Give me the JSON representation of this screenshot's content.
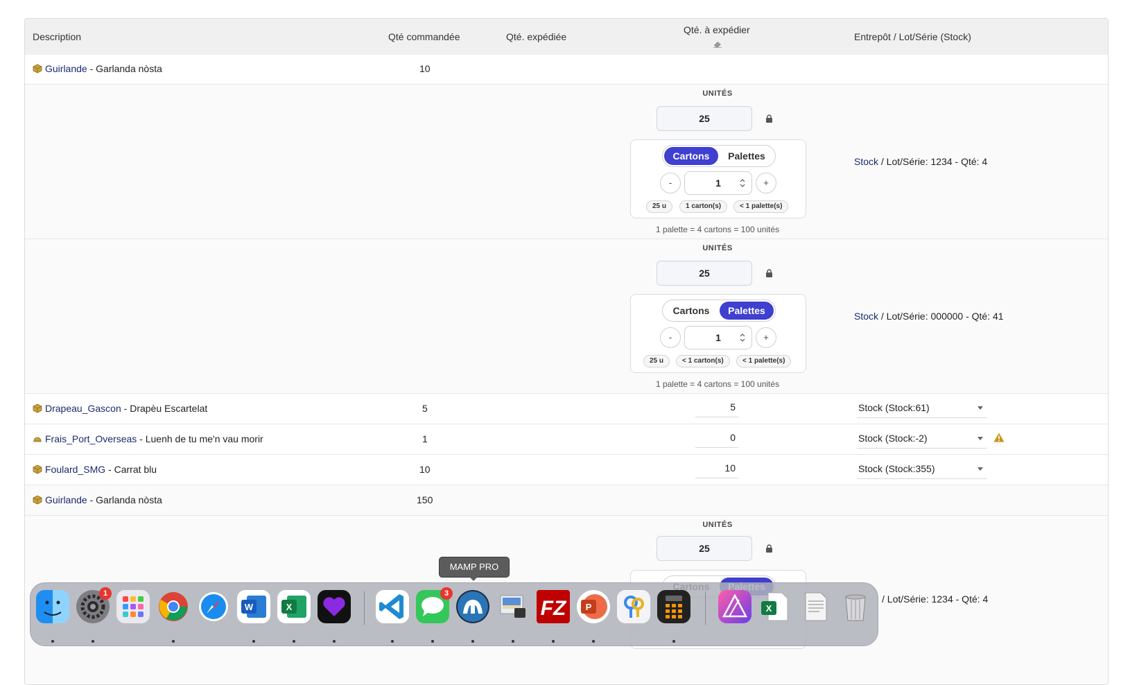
{
  "header": {
    "description": "Description",
    "ordered": "Qté commandée",
    "shipped": "Qté. expédiée",
    "to_ship": "Qté. à expédier",
    "warehouse": "Entrepôt / Lot/Série (Stock)"
  },
  "rows": [
    {
      "product": "Guirlande",
      "label": "Garlanda nòsta",
      "ordered": "10"
    },
    {
      "product": "Drapeau_Gascon",
      "label": "Drapèu Escartelat",
      "ordered": "5",
      "to_ship": "5",
      "stock": "Stock (Stock:61)"
    },
    {
      "product": "Frais_Port_Overseas",
      "label": "Luenh de tu me'n vau morir",
      "ordered": "1",
      "to_ship": "0",
      "stock": "Stock (Stock:-2)"
    },
    {
      "product": "Foulard_SMG",
      "label": "Carrat blu",
      "ordered": "10",
      "to_ship": "10",
      "stock": "Stock (Stock:355)"
    },
    {
      "product": "Guirlande",
      "label": "Garlanda nòsta",
      "ordered": "150"
    }
  ],
  "separator": " - ",
  "lots": [
    {
      "unites_label": "UNITÉS",
      "qty": "25",
      "tab_cartons": "Cartons",
      "tab_palettes": "Palettes",
      "active_tab": "Cartons",
      "minus": "-",
      "plus": "+",
      "input": "1",
      "pills": [
        "25 u",
        "1 carton(s)",
        "< 1 palette(s)"
      ],
      "footer": "1 palette = 4 cartons = 100 unités",
      "stock_link": "Stock",
      "stock_text": " / Lot/Série: 1234 - Qté: 4"
    },
    {
      "unites_label": "UNITÉS",
      "qty": "25",
      "tab_cartons": "Cartons",
      "tab_palettes": "Palettes",
      "active_tab": "Palettes",
      "minus": "-",
      "plus": "+",
      "input": "1",
      "pills": [
        "25 u",
        "< 1 carton(s)",
        "< 1 palette(s)"
      ],
      "footer": "1 palette = 4 cartons = 100 unités",
      "stock_link": "Stock",
      "stock_text": " / Lot/Série: 000000 - Qté: 41"
    },
    {
      "unites_label": "UNITÉS",
      "qty": "25",
      "tab_cartons": "Cartons",
      "tab_palettes": "Palettes",
      "active_tab": "Palettes",
      "stock_text": "/ Lot/Série: 1234 - Qté: 4"
    }
  ],
  "tooltip": "MAMP PRO",
  "dock": {
    "apps": [
      "Finder",
      "System Settings",
      "Launchpad",
      "Google Chrome",
      "Safari",
      "Microsoft Word",
      "Microsoft Excel",
      "Heart App",
      "Visual Studio Code",
      "Messages",
      "MAMP PRO",
      "Preview",
      "FileZilla",
      "Microsoft PowerPoint",
      "Keychain",
      "Calculator",
      "Affinity Photo",
      "Excel Document",
      "PDF Document",
      "Trash"
    ],
    "badges": {
      "settings": "1",
      "messages": "3"
    }
  },
  "colors": {
    "accent": "#3f3fd0",
    "link": "#1a2b6d",
    "warning": "#c8961a",
    "product_icon": "#b8902e"
  }
}
